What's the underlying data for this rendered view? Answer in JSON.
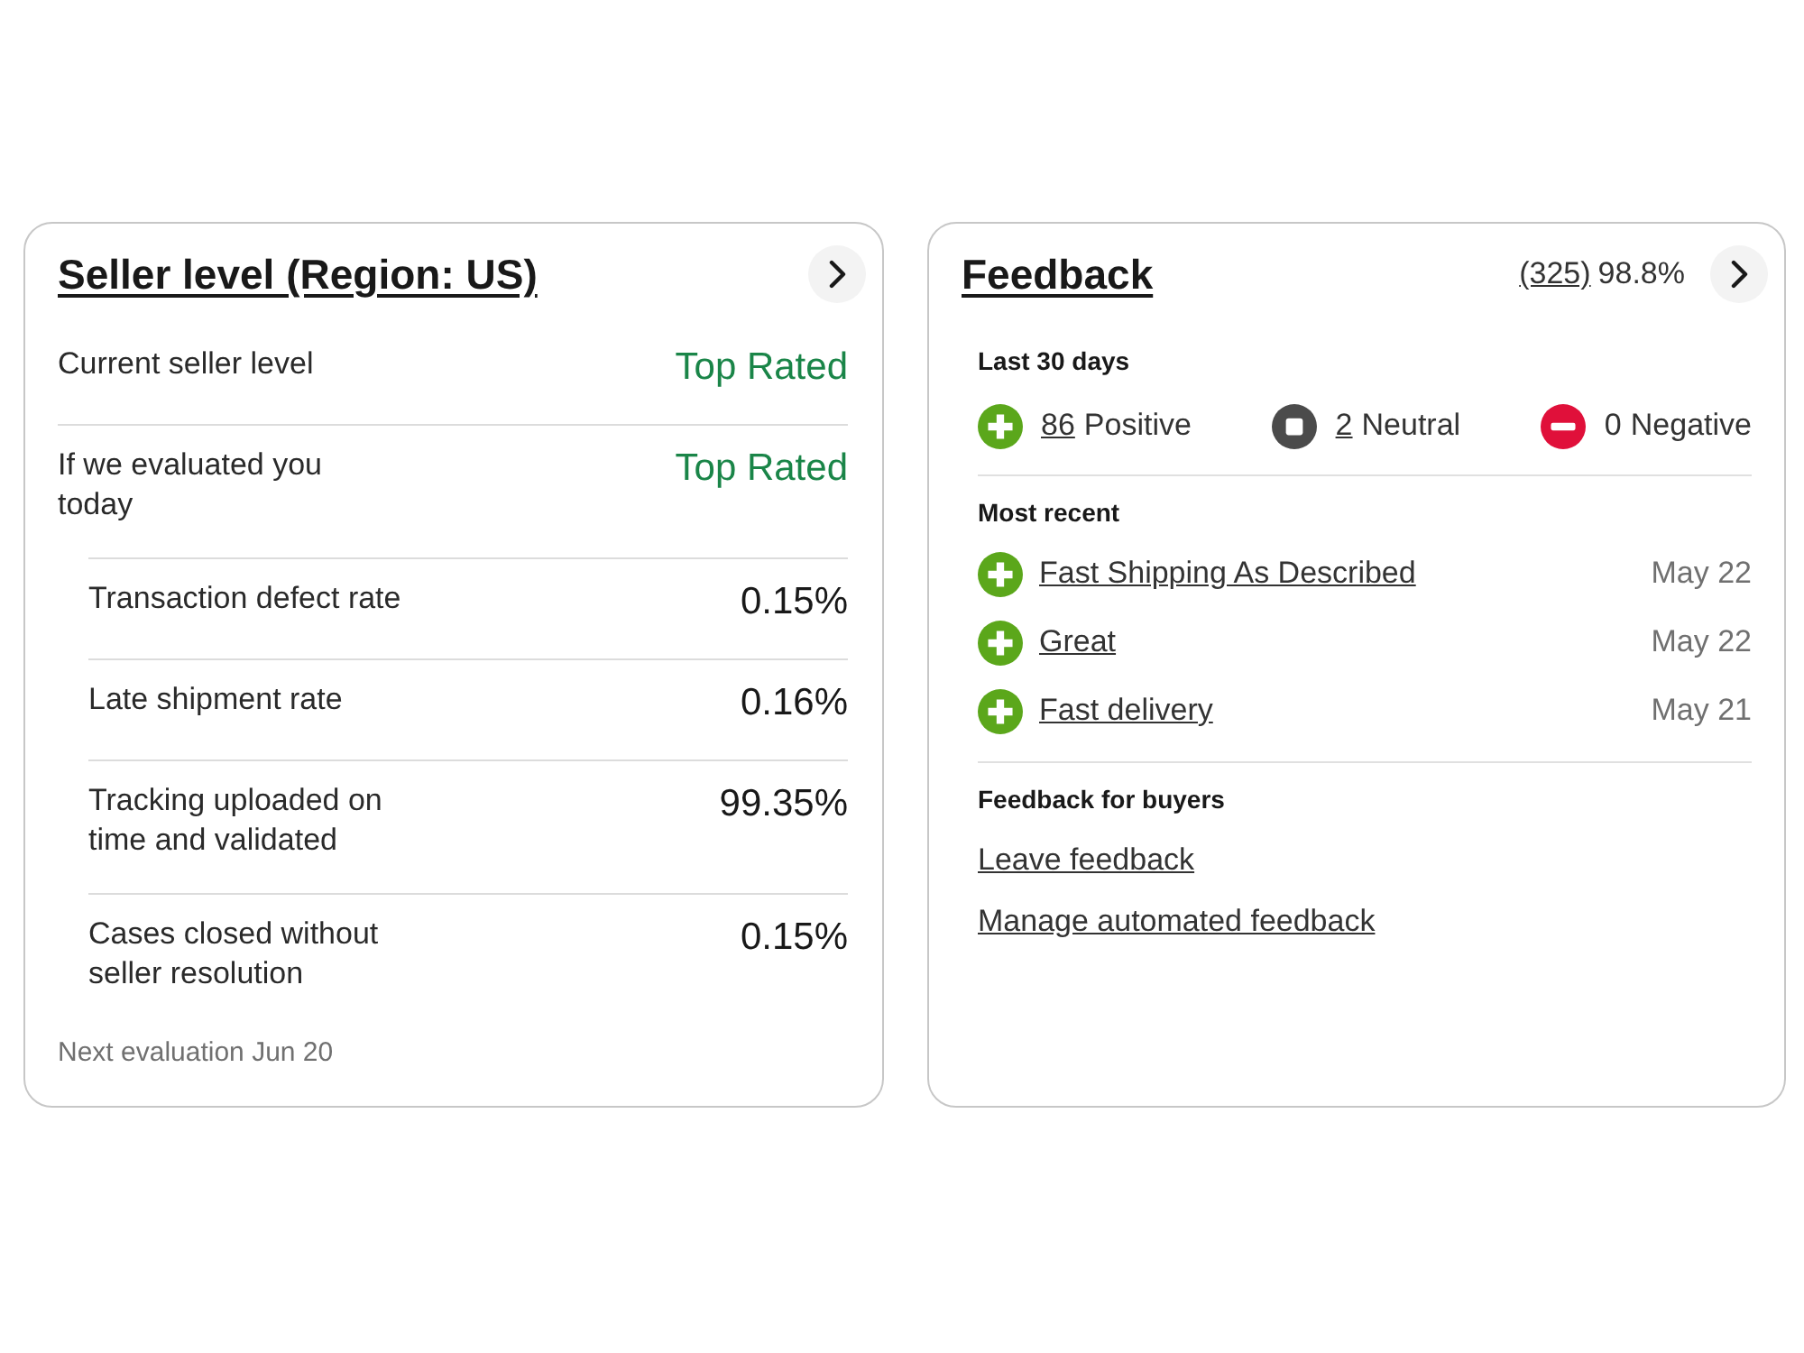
{
  "seller_level": {
    "title": "Seller level (Region: US)",
    "rows": [
      {
        "kind": "status",
        "label": "Current seller level",
        "value": "Top Rated"
      },
      {
        "kind": "status",
        "label": "If we evaluated you today",
        "value": "Top Rated"
      },
      {
        "kind": "metric",
        "label": "Transaction defect rate",
        "value": "0.15%"
      },
      {
        "kind": "metric",
        "label": "Late shipment rate",
        "value": "0.16%"
      },
      {
        "kind": "metric",
        "label": "Tracking uploaded on time and validated",
        "value": "99.35%"
      },
      {
        "kind": "metric",
        "label": "Cases closed without seller resolution",
        "value": "0.15%"
      }
    ],
    "next_evaluation": "Next evaluation Jun 20"
  },
  "feedback": {
    "title": "Feedback",
    "count": "(325)",
    "score": "98.8%",
    "last_30_days": {
      "heading": "Last 30 days",
      "summary": [
        {
          "kind": "positive",
          "count": "86",
          "label": "Positive",
          "linked": true
        },
        {
          "kind": "neutral",
          "count": "2",
          "label": "Neutral",
          "linked": true
        },
        {
          "kind": "negative",
          "count": "0",
          "label": "Negative",
          "linked": false
        }
      ]
    },
    "most_recent": {
      "heading": "Most recent",
      "items": [
        {
          "kind": "positive",
          "comment": "Fast Shipping As Described",
          "date": "May 22"
        },
        {
          "kind": "positive",
          "comment": "Great",
          "date": "May 22"
        },
        {
          "kind": "positive",
          "comment": "Fast delivery",
          "date": "May 21"
        }
      ]
    },
    "for_buyers": {
      "heading": "Feedback for buyers",
      "links": [
        "Leave feedback",
        "Manage automated feedback"
      ]
    }
  }
}
